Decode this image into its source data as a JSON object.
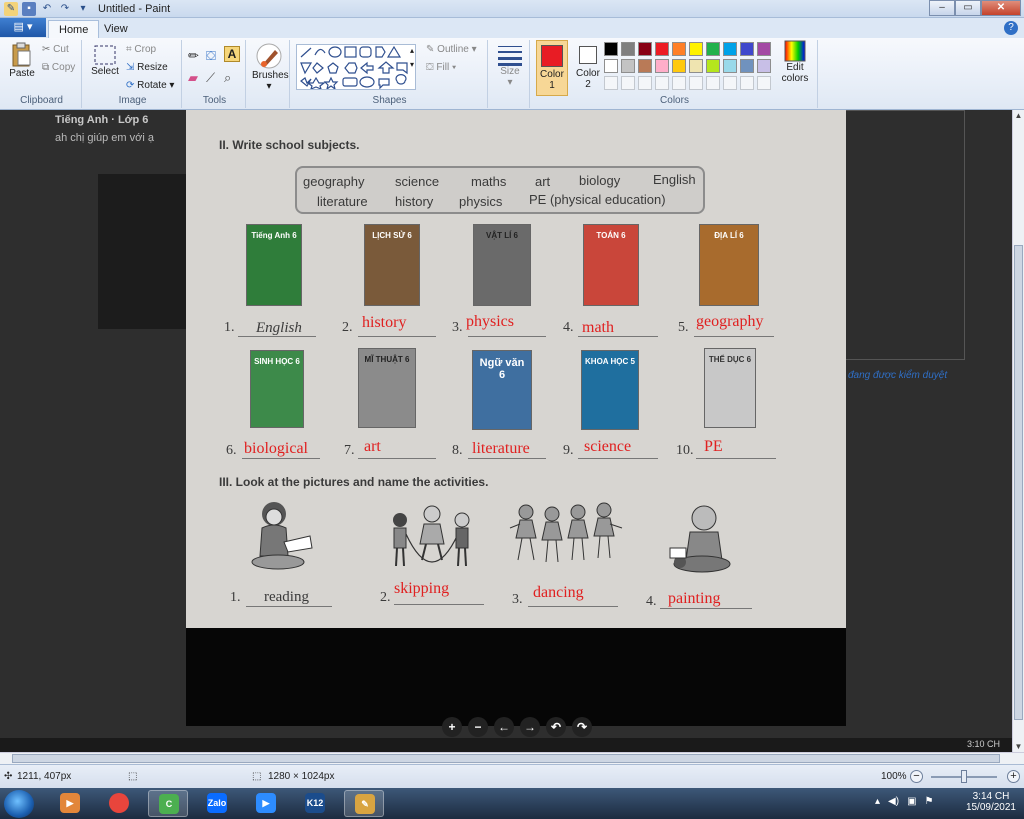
{
  "window": {
    "title": "Untitled - Paint",
    "minimize": "–",
    "maximize": "▭",
    "close": "✕"
  },
  "ribbon": {
    "file_label": "▤ ▾",
    "tabs": [
      {
        "label": "Home",
        "active": true
      },
      {
        "label": "View",
        "active": false
      }
    ],
    "help": "?",
    "clipboard": {
      "paste": "Paste",
      "cut": "Cut",
      "copy": "Copy",
      "group": "Clipboard"
    },
    "image": {
      "select": "Select",
      "crop": "Crop",
      "resize": "Resize",
      "rotate": "Rotate",
      "group": "Image"
    },
    "tools": {
      "group": "Tools"
    },
    "brushes": {
      "label": "Brushes"
    },
    "shapes": {
      "outline": "Outline",
      "fill": "Fill",
      "group": "Shapes"
    },
    "size": {
      "label": "Size"
    },
    "color1": {
      "label": "Color",
      "num": "1",
      "value": "#e81c24"
    },
    "color2": {
      "label": "Color",
      "num": "2",
      "value": "#ffffff"
    },
    "colors_group": "Colors",
    "edit_colors": "Edit colors",
    "palette_row1": [
      "#000000",
      "#7f7f7f",
      "#880015",
      "#ed1c24",
      "#ff7f27",
      "#fff200",
      "#22b14c",
      "#00a2e8",
      "#3f48cc",
      "#a349a4"
    ],
    "palette_row2": [
      "#ffffff",
      "#c3c3c3",
      "#b97a57",
      "#ffaec9",
      "#ffc90e",
      "#efe4b0",
      "#b5e61d",
      "#99d9ea",
      "#7092be",
      "#c8bfe7"
    ]
  },
  "background_page": {
    "heading": "Tiếng Anh · Lớp 6",
    "subtext": "ah chị giúp em với ạ",
    "status": "đang được kiểm duyệt"
  },
  "worksheet": {
    "section2_title": "II.  Write school subjects.",
    "word_bank_row1": [
      "geography",
      "science",
      "maths",
      "art",
      "biology",
      "English"
    ],
    "word_bank_row2": [
      "literature",
      "history",
      "physics",
      "PE (physical education)"
    ],
    "books": [
      {
        "title": "Tiếng Anh 6",
        "color": "#2f7d3a"
      },
      {
        "title": "LỊCH SỬ 6",
        "color": "#7a5a3a"
      },
      {
        "title": "VẬT LÍ 6",
        "color": "#6a6a6a"
      },
      {
        "title": "TOÁN 6",
        "color": "#c9463a"
      },
      {
        "title": "ĐỊA LÍ 6",
        "color": "#a86b2d"
      },
      {
        "title": "SINH HỌC 6",
        "color": "#3d8a4a"
      },
      {
        "title": "MĨ THUẬT 6",
        "color": "#8b8b8b"
      },
      {
        "title": "Ngữ văn 6",
        "color": "#3f6fa0"
      },
      {
        "title": "KHOA HỌC 5",
        "color": "#1f6f9f"
      },
      {
        "title": "THỂ DỤC 6",
        "color": "#c8c8c8"
      }
    ],
    "numbers_row1": [
      "1.",
      "2.",
      "3.",
      "4.",
      "5."
    ],
    "numbers_row2": [
      "6.",
      "7.",
      "8.",
      "9.",
      "10."
    ],
    "given_answer": "English",
    "answers_row1": [
      "history",
      "physics",
      "math",
      "geography"
    ],
    "answers_row2": [
      "biological",
      "art",
      "literature",
      "science",
      "PE"
    ],
    "section3_title": "III.  Look at the pictures and name the activities.",
    "activity_numbers": [
      "1.",
      "2.",
      "3.",
      "4."
    ],
    "activity_given": "reading",
    "activity_answers": [
      "skipping",
      "dancing",
      "painting"
    ]
  },
  "viewer_controls": [
    "+",
    "−",
    "←",
    "→",
    "↶",
    "↷"
  ],
  "peek_clock": "3:10 CH",
  "statusbar": {
    "cursor_pos": "1211, 407px",
    "image_size": "1280 × 1024px",
    "zoom": "100%"
  },
  "taskbar": {
    "apps": [
      {
        "name": "media",
        "label": "▶",
        "color": "#e2863a"
      },
      {
        "name": "chrome",
        "label": "",
        "color": "#e8453c"
      },
      {
        "name": "coccoc",
        "label": "C",
        "color": "#4caf50"
      },
      {
        "name": "zalo",
        "label": "Zalo",
        "color": "#0a6cff"
      },
      {
        "name": "zoom",
        "label": "▶",
        "color": "#2d8cff"
      },
      {
        "name": "k12",
        "label": "K12",
        "color": "#1b4c8c"
      },
      {
        "name": "paint",
        "label": "✎",
        "color": "#d9a441"
      }
    ],
    "time": "3:14 CH",
    "date": "15/09/2021"
  }
}
